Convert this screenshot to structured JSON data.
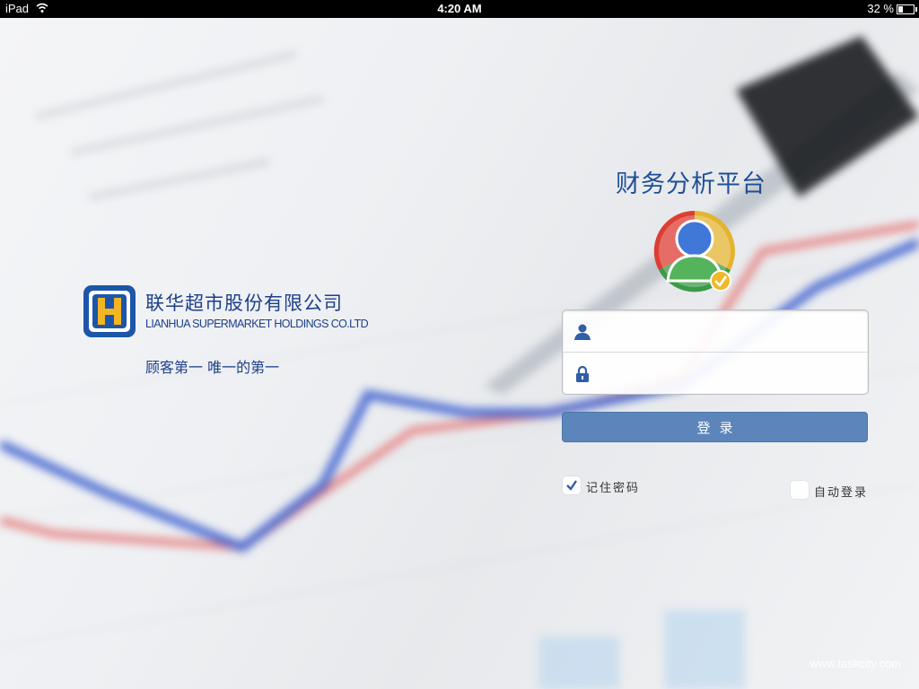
{
  "status_bar": {
    "device": "iPad",
    "time": "4:20 AM",
    "battery_percent": "32 %",
    "battery_level": 0.32
  },
  "brand": {
    "company_name_cn": "联华超市股份有限公司",
    "company_name_en": "LIANHUA SUPERMARKET HOLDINGS CO.LTD",
    "slogan": "顾客第一  唯一的第一"
  },
  "login": {
    "app_title": "财务分析平台",
    "username": {
      "value": "",
      "placeholder": "",
      "icon": "user-icon"
    },
    "password": {
      "value": "",
      "placeholder": "",
      "icon": "lock-icon"
    },
    "submit_label": "登录",
    "remember_password": {
      "label": "记住密码",
      "checked": true
    },
    "auto_login": {
      "label": "自动登录",
      "checked": false
    }
  },
  "watermark": "www.taskcity.com",
  "colors": {
    "brand_blue": "#1d3f8a",
    "title_blue": "#1f4f95",
    "button_blue": "#5b85bb"
  }
}
